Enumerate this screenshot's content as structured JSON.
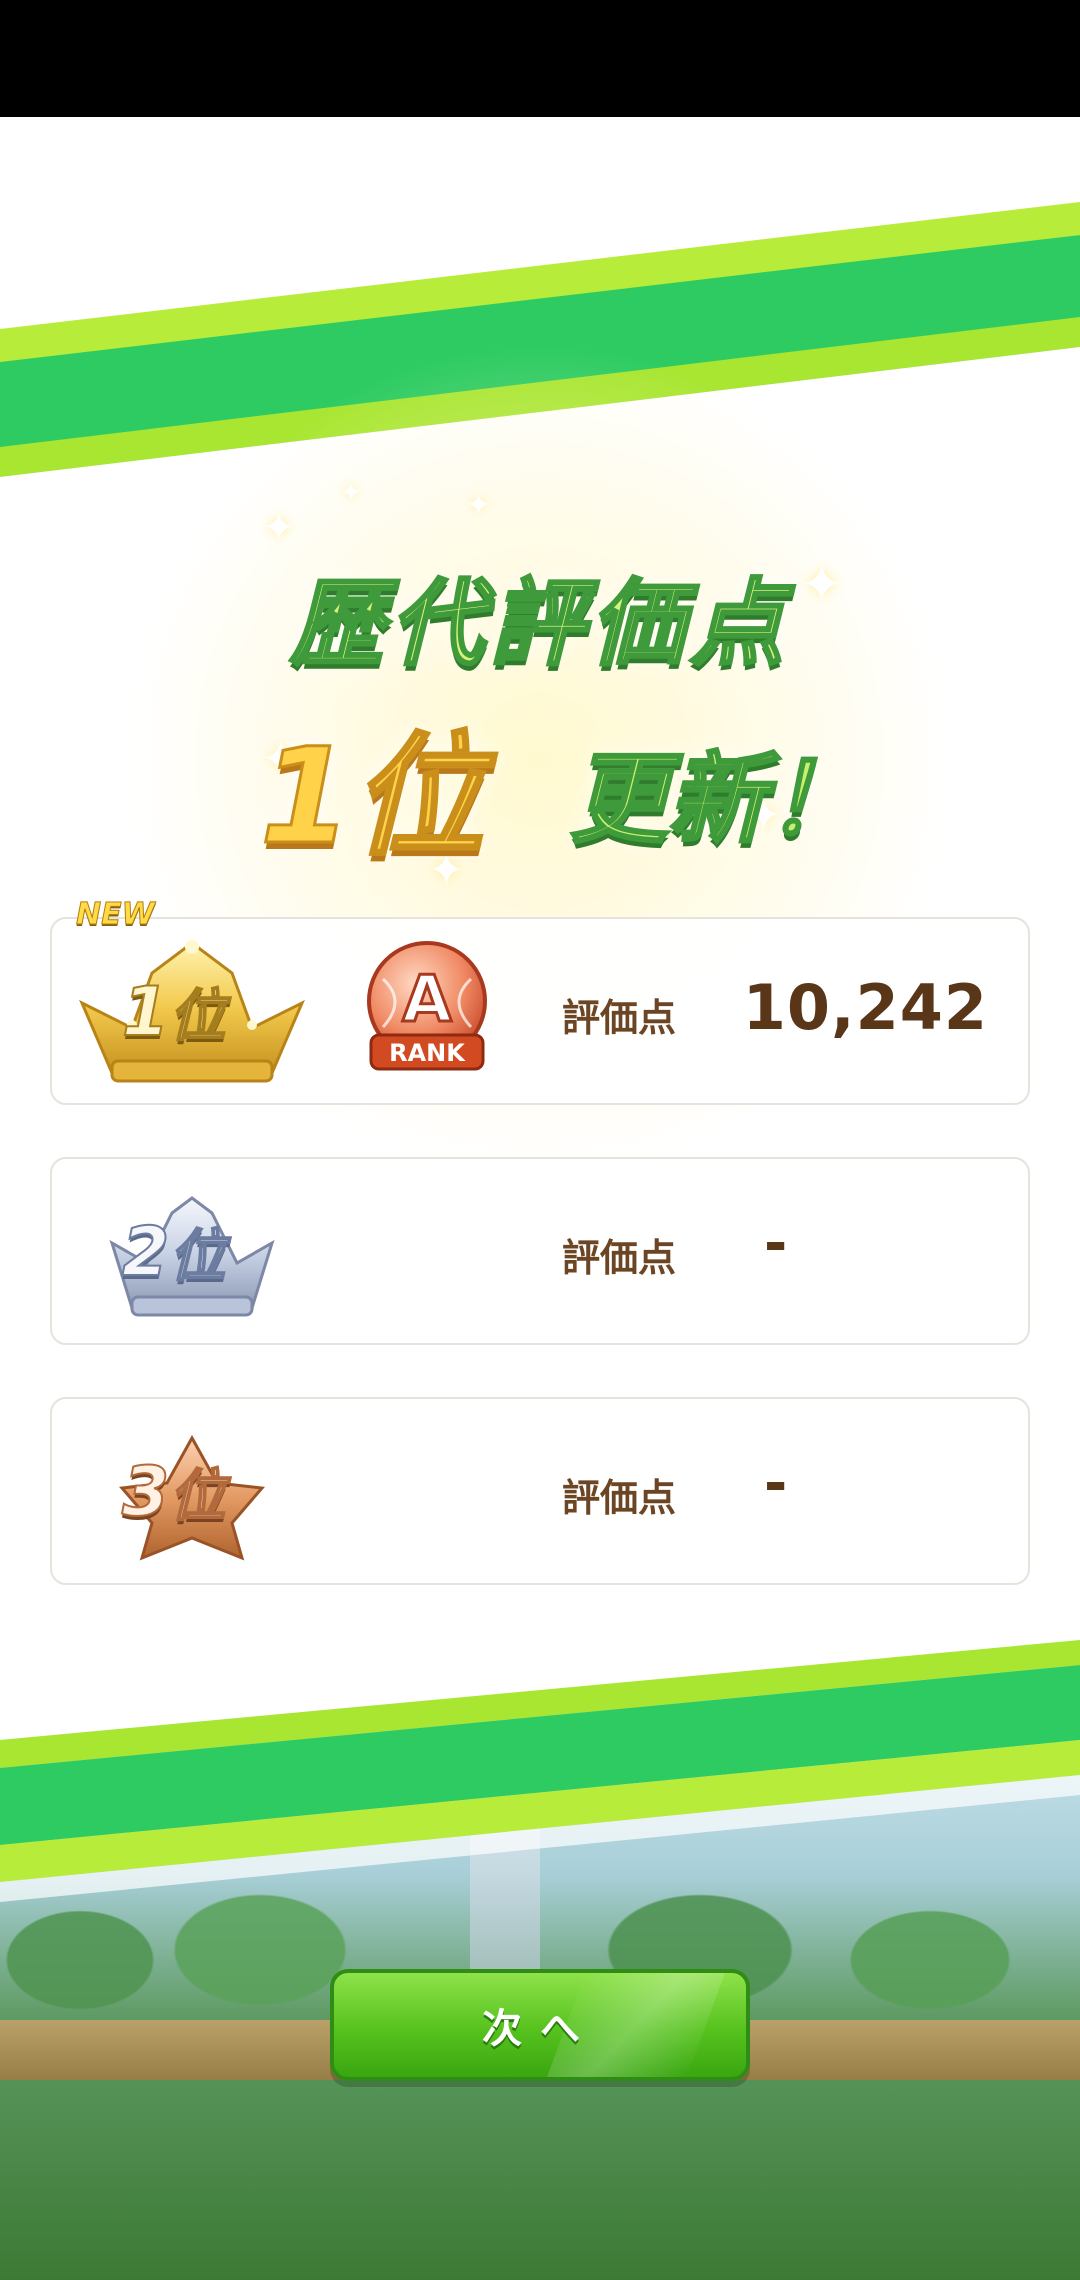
{
  "heading": {
    "line1": "歴代評価点",
    "rank": "1位",
    "update": "更新！"
  },
  "ranking": [
    {
      "rank_digit": "1",
      "rank_suffix": "位",
      "badge_new": "NEW",
      "grade_letter": "A",
      "grade_label": "RANK",
      "score_label": "評価点",
      "score_value": "10,242",
      "crown": "gold-crown-icon"
    },
    {
      "rank_digit": "2",
      "rank_suffix": "位",
      "score_label": "評価点",
      "score_value": "-",
      "crown": "silver-crown-icon"
    },
    {
      "rank_digit": "3",
      "rank_suffix": "位",
      "score_label": "評価点",
      "score_value": "-",
      "crown": "bronze-crown-icon"
    }
  ],
  "next_button": {
    "label": "次へ"
  },
  "colors": {
    "stripe_green": "#2ecb63",
    "stripe_lime": "#a8e632",
    "score_brown": "#5a3618",
    "button_green": "#56c21e"
  }
}
